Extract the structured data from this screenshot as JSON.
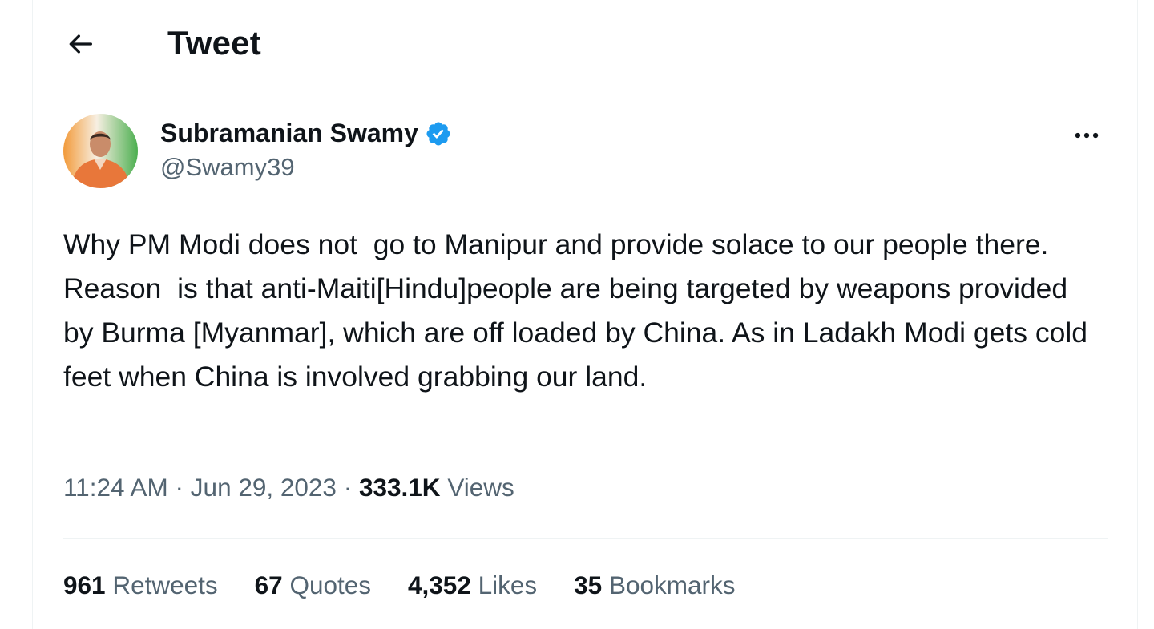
{
  "header": {
    "title": "Tweet",
    "back_icon": "arrow-left-icon"
  },
  "author": {
    "display_name": "Subramanian Swamy",
    "handle": "@Swamy39",
    "verified": true,
    "verified_color": "#1d9bf0"
  },
  "tweet": {
    "text": "Why PM Modi does not  go to Manipur and provide solace to our people there. Reason  is that anti-Maiti[Hindu]people are being targeted by weapons provided by Burma [Myanmar], which are off loaded by China. As in Ladakh Modi gets cold feet when China is involved grabbing our land."
  },
  "meta": {
    "time": "11:24 AM",
    "separator": "·",
    "date": "Jun 29, 2023",
    "views_count": "333.1K",
    "views_label": "Views"
  },
  "stats": [
    {
      "count": "961",
      "label": "Retweets"
    },
    {
      "count": "67",
      "label": "Quotes"
    },
    {
      "count": "4,352",
      "label": "Likes"
    },
    {
      "count": "35",
      "label": "Bookmarks"
    }
  ],
  "colors": {
    "text_primary": "#0f1419",
    "text_secondary": "#536471",
    "divider": "#eff3f4"
  }
}
